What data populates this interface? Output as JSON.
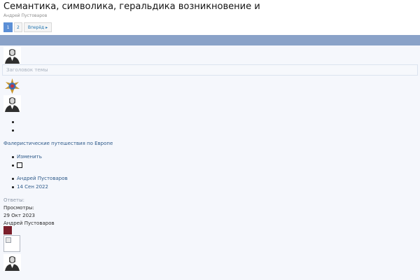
{
  "thread": {
    "title": "Семантика, символика, геральдика возникновение и",
    "author": "Андрей Пустоваров"
  },
  "pagination": {
    "pages": [
      "1",
      "2"
    ],
    "current": "1",
    "next_label": "Вперёд ▸"
  },
  "composer": {
    "title_placeholder": "Заголовок темы"
  },
  "forum": {
    "name": "Фалеристические путешествия по Европе"
  },
  "actions": {
    "edit_label": "Изменить"
  },
  "meta": {
    "author": "Андрей Пустоваров",
    "date": "14 Сен 2022"
  },
  "stats": {
    "replies_label": "Ответы:",
    "views_label": "Просмотры:",
    "last_date": "29 Окт 2023",
    "last_author": "Андрей Пустоваров"
  },
  "colors": {
    "header_bar": "#8aa2c8",
    "link": "#2e5a8a",
    "current_page": "#5b8fd6",
    "content_bg": "#f5f7fc"
  }
}
